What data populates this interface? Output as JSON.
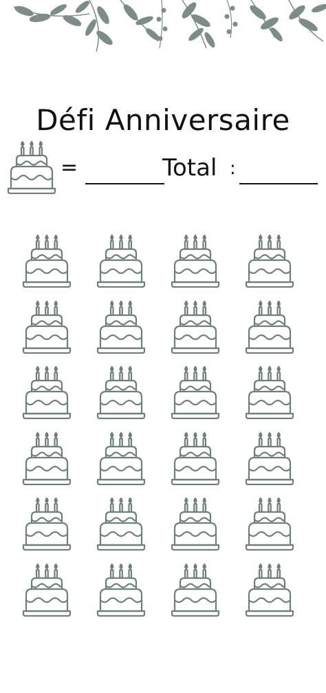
{
  "title": "Défi Anniversaire",
  "legend": {
    "equals": "=",
    "total_label": "Total",
    "colon": ":"
  },
  "grid": {
    "rows": 6,
    "columns": 4
  },
  "colors": {
    "accent": "#6f7e7b",
    "text": "#111111"
  },
  "icons": [
    "leaf-garland-icon",
    "birthday-cake-icon"
  ]
}
